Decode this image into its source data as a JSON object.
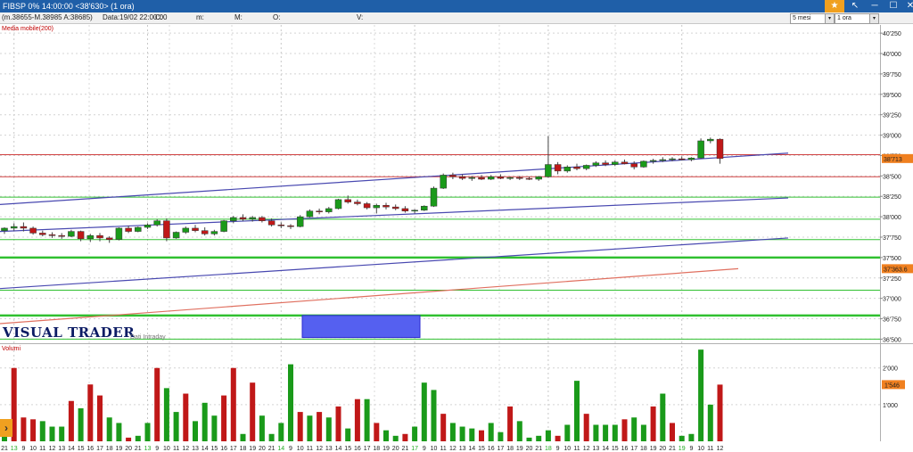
{
  "window": {
    "title": "FIBSP 0% 14:00:00   <38'630>  (1 ora)"
  },
  "infobar": {
    "quote": "(m.38655-M.38985 A:38685)",
    "data_label": "Data:19/02 22:00:00",
    "fields": [
      "C:",
      "m:",
      "M:",
      "O:",
      "V:"
    ]
  },
  "controls": {
    "period": "5 mesi",
    "interval": "1 ora"
  },
  "indicators": {
    "price_label": "Media mobile(200)",
    "volume_label": "Volumi"
  },
  "branding": {
    "logo": "VISUAL TRADER",
    "subtitle": "Dati Intraday"
  },
  "colors": {
    "up": "#1a9a1a",
    "down": "#c01818",
    "trendline": "#4848b0",
    "ma": "#e07060",
    "hline_red": "#d04040",
    "hline_green": "#30c030",
    "marker": "#f08020",
    "box": "#5560f0"
  },
  "chart_data": [
    {
      "type": "candlestick",
      "y_axis_ticks": [
        "40'250",
        "40'000",
        "39'750",
        "39'500",
        "39'250",
        "39'000",
        "38'750",
        "38'500",
        "38'250",
        "38'000",
        "37'750",
        "37'500",
        "37'250",
        "37'000",
        "36'750",
        "36'500"
      ],
      "y_tick_values": [
        40250,
        40000,
        39750,
        39500,
        39250,
        39000,
        38750,
        38500,
        38250,
        38000,
        37750,
        37500,
        37250,
        37000,
        36750,
        36500
      ],
      "ylim": [
        36450,
        40350
      ],
      "x_ticks": [
        "21",
        "13",
        "9",
        "10",
        "11",
        "12",
        "13",
        "14",
        "15",
        "16",
        "17",
        "18",
        "19",
        "20",
        "21",
        "13",
        "9",
        "10",
        "11",
        "12",
        "13",
        "14",
        "15",
        "16",
        "17",
        "18",
        "19",
        "20",
        "21",
        "14",
        "9",
        "10",
        "11",
        "12",
        "13",
        "14",
        "15",
        "16",
        "17",
        "18",
        "19",
        "20",
        "21",
        "17",
        "9",
        "10",
        "11",
        "12",
        "13",
        "14",
        "15",
        "16",
        "17",
        "18",
        "19",
        "20",
        "21",
        "18",
        "9",
        "10",
        "11",
        "12",
        "13",
        "14",
        "15",
        "16",
        "17",
        "18",
        "19",
        "20",
        "21",
        "19",
        "9",
        "10",
        "11",
        "12"
      ],
      "x_tick_highlight": [
        1,
        15,
        29,
        43,
        57,
        71
      ],
      "price_markers": [
        "38'713",
        "37'363.6"
      ],
      "candles": [
        {
          "o": 37830,
          "h": 37870,
          "l": 37790,
          "c": 37860
        },
        {
          "o": 37860,
          "h": 37920,
          "l": 37830,
          "c": 37880
        },
        {
          "o": 37880,
          "h": 37930,
          "l": 37820,
          "c": 37860
        },
        {
          "o": 37860,
          "h": 37880,
          "l": 37780,
          "c": 37800
        },
        {
          "o": 37800,
          "h": 37830,
          "l": 37760,
          "c": 37780
        },
        {
          "o": 37780,
          "h": 37810,
          "l": 37740,
          "c": 37770
        },
        {
          "o": 37770,
          "h": 37800,
          "l": 37730,
          "c": 37760
        },
        {
          "o": 37760,
          "h": 37840,
          "l": 37750,
          "c": 37820
        },
        {
          "o": 37820,
          "h": 37830,
          "l": 37700,
          "c": 37730
        },
        {
          "o": 37730,
          "h": 37790,
          "l": 37690,
          "c": 37770
        },
        {
          "o": 37770,
          "h": 37800,
          "l": 37700,
          "c": 37740
        },
        {
          "o": 37740,
          "h": 37760,
          "l": 37680,
          "c": 37720
        },
        {
          "o": 37720,
          "h": 37870,
          "l": 37710,
          "c": 37860
        },
        {
          "o": 37860,
          "h": 37890,
          "l": 37800,
          "c": 37820
        },
        {
          "o": 37820,
          "h": 37880,
          "l": 37810,
          "c": 37870
        },
        {
          "o": 37870,
          "h": 37920,
          "l": 37850,
          "c": 37900
        },
        {
          "o": 37900,
          "h": 37970,
          "l": 37880,
          "c": 37950
        },
        {
          "o": 37950,
          "h": 37980,
          "l": 37700,
          "c": 37740
        },
        {
          "o": 37740,
          "h": 37820,
          "l": 37730,
          "c": 37810
        },
        {
          "o": 37810,
          "h": 37880,
          "l": 37790,
          "c": 37860
        },
        {
          "o": 37860,
          "h": 37900,
          "l": 37810,
          "c": 37830
        },
        {
          "o": 37830,
          "h": 37870,
          "l": 37770,
          "c": 37790
        },
        {
          "o": 37790,
          "h": 37840,
          "l": 37770,
          "c": 37820
        },
        {
          "o": 37820,
          "h": 37960,
          "l": 37810,
          "c": 37950
        },
        {
          "o": 37950,
          "h": 38010,
          "l": 37920,
          "c": 37990
        },
        {
          "o": 37990,
          "h": 38030,
          "l": 37950,
          "c": 37970
        },
        {
          "o": 37970,
          "h": 38010,
          "l": 37940,
          "c": 37990
        },
        {
          "o": 37990,
          "h": 38010,
          "l": 37930,
          "c": 37950
        },
        {
          "o": 37950,
          "h": 37980,
          "l": 37880,
          "c": 37900
        },
        {
          "o": 37900,
          "h": 37930,
          "l": 37860,
          "c": 37890
        },
        {
          "o": 37890,
          "h": 37910,
          "l": 37850,
          "c": 37880
        },
        {
          "o": 37880,
          "h": 38020,
          "l": 37870,
          "c": 38000
        },
        {
          "o": 38000,
          "h": 38090,
          "l": 37990,
          "c": 38070
        },
        {
          "o": 38070,
          "h": 38100,
          "l": 38030,
          "c": 38060
        },
        {
          "o": 38060,
          "h": 38120,
          "l": 38040,
          "c": 38100
        },
        {
          "o": 38100,
          "h": 38220,
          "l": 38090,
          "c": 38210
        },
        {
          "o": 38210,
          "h": 38260,
          "l": 38160,
          "c": 38180
        },
        {
          "o": 38180,
          "h": 38210,
          "l": 38140,
          "c": 38160
        },
        {
          "o": 38160,
          "h": 38180,
          "l": 38090,
          "c": 38110
        },
        {
          "o": 38110,
          "h": 38160,
          "l": 38040,
          "c": 38140
        },
        {
          "o": 38140,
          "h": 38170,
          "l": 38090,
          "c": 38120
        },
        {
          "o": 38120,
          "h": 38150,
          "l": 38080,
          "c": 38100
        },
        {
          "o": 38100,
          "h": 38130,
          "l": 38050,
          "c": 38070
        },
        {
          "o": 38070,
          "h": 38090,
          "l": 38040,
          "c": 38080
        },
        {
          "o": 38080,
          "h": 38140,
          "l": 38070,
          "c": 38130
        },
        {
          "o": 38130,
          "h": 38370,
          "l": 38120,
          "c": 38350
        },
        {
          "o": 38350,
          "h": 38530,
          "l": 38340,
          "c": 38510
        },
        {
          "o": 38510,
          "h": 38540,
          "l": 38460,
          "c": 38490
        },
        {
          "o": 38490,
          "h": 38520,
          "l": 38450,
          "c": 38470
        },
        {
          "o": 38470,
          "h": 38500,
          "l": 38440,
          "c": 38480
        },
        {
          "o": 38480,
          "h": 38510,
          "l": 38450,
          "c": 38460
        },
        {
          "o": 38460,
          "h": 38510,
          "l": 38450,
          "c": 38490
        },
        {
          "o": 38490,
          "h": 38520,
          "l": 38460,
          "c": 38470
        },
        {
          "o": 38470,
          "h": 38490,
          "l": 38450,
          "c": 38480
        },
        {
          "o": 38480,
          "h": 38500,
          "l": 38450,
          "c": 38470
        },
        {
          "o": 38470,
          "h": 38490,
          "l": 38450,
          "c": 38460
        },
        {
          "o": 38460,
          "h": 38500,
          "l": 38440,
          "c": 38490
        },
        {
          "o": 38490,
          "h": 38990,
          "l": 38480,
          "c": 38640
        },
        {
          "o": 38640,
          "h": 38670,
          "l": 38520,
          "c": 38560
        },
        {
          "o": 38560,
          "h": 38630,
          "l": 38540,
          "c": 38610
        },
        {
          "o": 38610,
          "h": 38650,
          "l": 38570,
          "c": 38590
        },
        {
          "o": 38590,
          "h": 38640,
          "l": 38570,
          "c": 38630
        },
        {
          "o": 38630,
          "h": 38680,
          "l": 38610,
          "c": 38660
        },
        {
          "o": 38660,
          "h": 38690,
          "l": 38620,
          "c": 38640
        },
        {
          "o": 38640,
          "h": 38690,
          "l": 38620,
          "c": 38670
        },
        {
          "o": 38670,
          "h": 38700,
          "l": 38640,
          "c": 38650
        },
        {
          "o": 38650,
          "h": 38680,
          "l": 38580,
          "c": 38610
        },
        {
          "o": 38610,
          "h": 38690,
          "l": 38600,
          "c": 38680
        },
        {
          "o": 38680,
          "h": 38710,
          "l": 38650,
          "c": 38690
        },
        {
          "o": 38690,
          "h": 38730,
          "l": 38670,
          "c": 38700
        },
        {
          "o": 38700,
          "h": 38730,
          "l": 38680,
          "c": 38710
        },
        {
          "o": 38710,
          "h": 38740,
          "l": 38690,
          "c": 38700
        },
        {
          "o": 38700,
          "h": 38730,
          "l": 38680,
          "c": 38720
        },
        {
          "o": 38720,
          "h": 38960,
          "l": 38710,
          "c": 38930
        },
        {
          "o": 38930,
          "h": 38970,
          "l": 38900,
          "c": 38950
        },
        {
          "o": 38950,
          "h": 38960,
          "l": 38650,
          "c": 38713
        }
      ],
      "moving_average_200": [
        36690,
        37363.6
      ],
      "trendlines": [
        {
          "from": 38150,
          "to": 38780
        },
        {
          "from": 37820,
          "to": 38230
        },
        {
          "from": 37120,
          "to": 37740
        }
      ],
      "horizontal_levels": [
        {
          "value": 38760,
          "color": "red"
        },
        {
          "value": 38490,
          "color": "red"
        },
        {
          "value": 38240,
          "color": "green"
        },
        {
          "value": 37970,
          "color": "green"
        },
        {
          "value": 37720,
          "color": "green"
        },
        {
          "value": 37500,
          "color": "green",
          "bold": true
        },
        {
          "value": 37100,
          "color": "green"
        },
        {
          "value": 36790,
          "color": "green",
          "bold": true
        },
        {
          "value": 36500,
          "color": "green"
        }
      ]
    },
    {
      "type": "bar",
      "title": "Volumi",
      "y_axis_ticks": [
        "2'000",
        "1'000"
      ],
      "y_tick_values": [
        2000,
        1000
      ],
      "ylim": [
        0,
        2650
      ],
      "price_markers": [
        "1'546"
      ],
      "values": [
        300,
        2000,
        650,
        600,
        550,
        400,
        400,
        1100,
        900,
        1550,
        1250,
        650,
        500,
        100,
        150,
        500,
        2000,
        1450,
        800,
        1300,
        550,
        1050,
        700,
        1250,
        2000,
        200,
        1600,
        700,
        200,
        500,
        2100,
        800,
        700,
        800,
        650,
        950,
        350,
        1150,
        1150,
        500,
        300,
        150,
        200,
        400,
        1600,
        1400,
        750,
        500,
        400,
        350,
        300,
        500,
        250,
        950,
        550,
        100,
        150,
        300,
        150,
        450,
        1650,
        750,
        450,
        450,
        450,
        600,
        650,
        450,
        950,
        1300,
        500,
        150,
        200,
        2500,
        1000,
        1546
      ],
      "up": [
        1,
        0,
        0,
        0,
        1,
        1,
        1,
        0,
        1,
        0,
        0,
        1,
        1,
        0,
        1,
        1,
        0,
        1,
        1,
        0,
        1,
        1,
        1,
        0,
        0,
        1,
        0,
        1,
        1,
        1,
        1,
        0,
        1,
        0,
        1,
        0,
        1,
        0,
        1,
        0,
        1,
        1,
        0,
        1,
        1,
        1,
        0,
        1,
        1,
        1,
        0,
        1,
        1,
        0,
        1,
        1,
        1,
        1,
        0,
        1,
        1,
        0,
        1,
        1,
        1,
        0,
        1,
        1,
        0,
        1,
        0,
        1,
        1,
        1,
        1,
        0
      ]
    }
  ]
}
